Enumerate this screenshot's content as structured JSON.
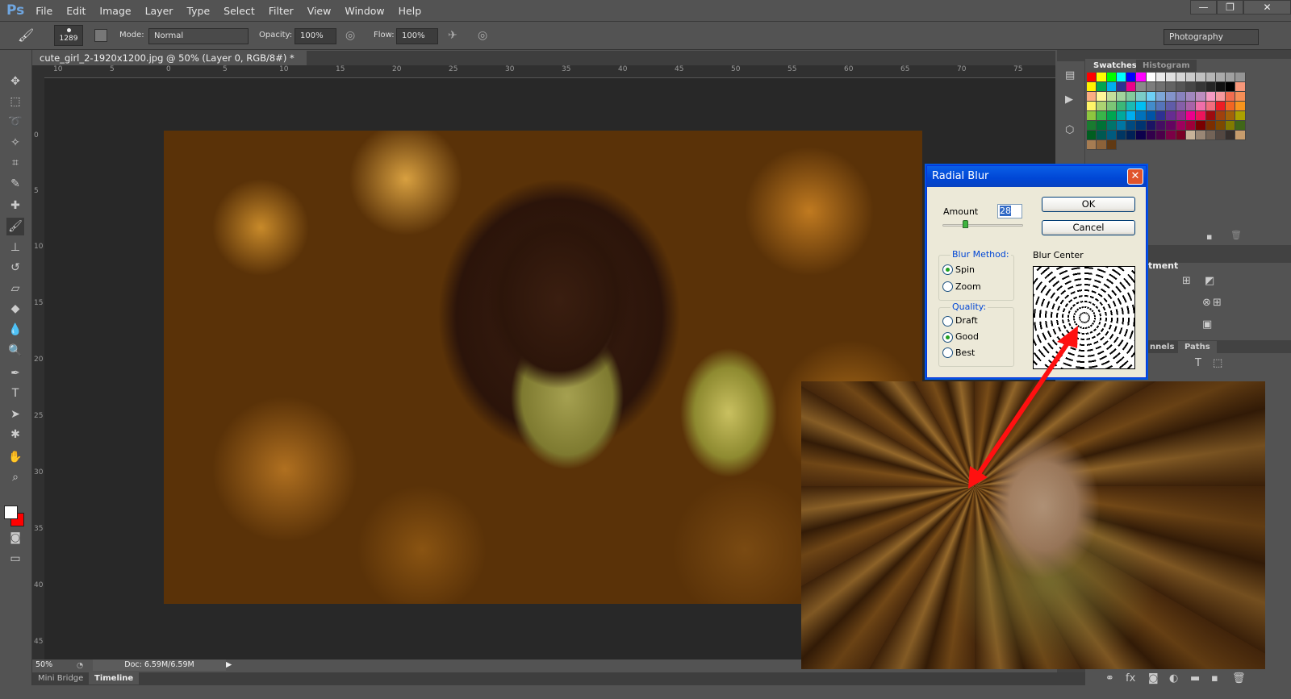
{
  "app": {
    "logo": "Ps",
    "window_controls": {
      "minimize": "—",
      "restore": "❐",
      "close": "✕"
    }
  },
  "menu": [
    "File",
    "Edit",
    "Image",
    "Layer",
    "Type",
    "Select",
    "Filter",
    "View",
    "Window",
    "Help"
  ],
  "options": {
    "brush_size": "1289",
    "mode_label": "Mode:",
    "mode_value": "Normal",
    "opacity_label": "Opacity:",
    "opacity_value": "100%",
    "flow_label": "Flow:",
    "flow_value": "100%",
    "workspace": "Photography"
  },
  "document": {
    "tab_title": "cute_girl_2-1920x1200.jpg @ 50% (Layer 0, RGB/8#) *",
    "close": "×"
  },
  "rulers": {
    "horizontal": [
      "10",
      "5",
      "0",
      "5",
      "10",
      "15",
      "20",
      "25",
      "30",
      "35",
      "40",
      "45",
      "50",
      "55",
      "60",
      "65",
      "70",
      "75"
    ],
    "vertical": [
      "0",
      "5",
      "10",
      "15",
      "20",
      "25",
      "30",
      "35",
      "40",
      "45"
    ]
  },
  "status": {
    "zoom": "50%",
    "doc": "Doc: 6.59M/6.59M"
  },
  "bottom_tabs": [
    "Mini Bridge",
    "Timeline"
  ],
  "panels": {
    "swatches_tab": "Swatches",
    "histogram_tab": "Histogram",
    "adjustments_title": "tment",
    "channels_tab": "nnels",
    "paths_tab": "Paths",
    "swatch_colors": [
      "#ff0000",
      "#ffff00",
      "#00ff00",
      "#00ffff",
      "#0000ff",
      "#ff00ff",
      "#ffffff",
      "#ebebeb",
      "#e0e0e0",
      "#d6d6d6",
      "#cbcbcb",
      "#c0c0c0",
      "#b5b5b5",
      "#aaaaaa",
      "#a0a0a0",
      "#959595",
      "#fff200",
      "#00a651",
      "#00aeef",
      "#2e3192",
      "#ec008c",
      "#898989",
      "#7d7d7d",
      "#707070",
      "#636363",
      "#555555",
      "#464646",
      "#363636",
      "#252525",
      "#111111",
      "#000000",
      "#f7977a",
      "#fbad82",
      "#fff799",
      "#c4df9b",
      "#a2d39c",
      "#82ca9c",
      "#7accc8",
      "#6dcff6",
      "#7da7d8",
      "#8393ca",
      "#8882be",
      "#a187be",
      "#bc8dbf",
      "#f49ac2",
      "#f6989d",
      "#f26c4f",
      "#f68e56",
      "#fff568",
      "#acd372",
      "#7cc576",
      "#3bb878",
      "#1abbb4",
      "#00bff3",
      "#438ccb",
      "#5574b9",
      "#605ca8",
      "#855fa8",
      "#a763a8",
      "#f06ea9",
      "#f26d7d",
      "#ed1c24",
      "#f26522",
      "#f7941d",
      "#8dc63f",
      "#39b54a",
      "#00a651",
      "#00a99d",
      "#00aeef",
      "#0072bc",
      "#0054a6",
      "#2e3192",
      "#662d91",
      "#92278f",
      "#ec008c",
      "#ed145b",
      "#9e0b0f",
      "#a0410d",
      "#a36209",
      "#aba000",
      "#197b30",
      "#007236",
      "#00746b",
      "#0076a3",
      "#004a80",
      "#003471",
      "#1b1464",
      "#440e62",
      "#630460",
      "#9e005d",
      "#9e0039",
      "#790000",
      "#7b2e00",
      "#7d4900",
      "#827b00",
      "#406618",
      "#005e20",
      "#005952",
      "#005b7f",
      "#003663",
      "#002157",
      "#0d004c",
      "#32004b",
      "#4b0049",
      "#7b0046",
      "#7a0026",
      "#c7b299",
      "#998675",
      "#736357",
      "#534741",
      "#362f2d",
      "#c69c6d",
      "#a67c52",
      "#8c6239",
      "#603913"
    ]
  },
  "dialog": {
    "title": "Radial Blur",
    "close": "✕",
    "amount_label": "Amount",
    "amount_value": "28",
    "amount_fraction": 0.28,
    "ok": "OK",
    "cancel": "Cancel",
    "blur_method_label": "Blur Method:",
    "spin": "Spin",
    "zoom": "Zoom",
    "method_selected": "Spin",
    "quality_label": "Quality:",
    "draft": "Draft",
    "good": "Good",
    "best": "Best",
    "quality_selected": "Good",
    "blur_center_label": "Blur Center"
  },
  "colors": {
    "foreground": "#ffffff",
    "background": "#ff0000",
    "annotation_arrow": "#ff0000"
  }
}
